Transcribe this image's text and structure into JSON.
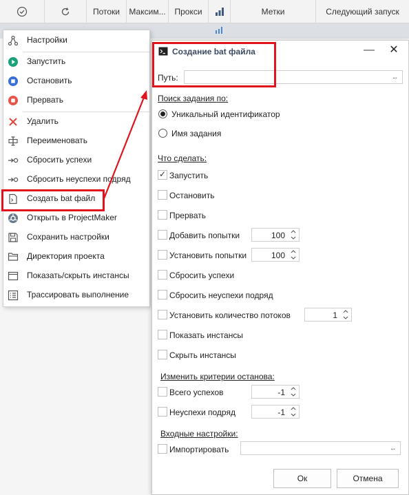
{
  "grid": {
    "columns": [
      "",
      "",
      "Потоки",
      "Максим...",
      "Прокси",
      "",
      "Метки",
      "Следующий запуск"
    ]
  },
  "context_menu": {
    "items": [
      {
        "label": "Настройки",
        "icon": "settings-icon"
      },
      {
        "label": "Запустить",
        "icon": "play-icon"
      },
      {
        "label": "Остановить",
        "icon": "stop-icon"
      },
      {
        "label": "Прервать",
        "icon": "abort-icon"
      },
      {
        "label": "Удалить",
        "icon": "delete-icon"
      },
      {
        "label": "Переименовать",
        "icon": "rename-icon"
      },
      {
        "label": "Сбросить успехи",
        "icon": "reset-success-icon"
      },
      {
        "label": "Сбросить неуспехи подряд",
        "icon": "reset-fails-icon"
      },
      {
        "label": "Создать bat файл",
        "icon": "bat-file-icon"
      },
      {
        "label": "Открыть в ProjectMaker",
        "icon": "projectmaker-icon"
      },
      {
        "label": "Сохранить настройки",
        "icon": "save-icon"
      },
      {
        "label": "Директория проекта",
        "icon": "folder-icon"
      },
      {
        "label": "Показать/скрыть инстансы",
        "icon": "window-icon"
      },
      {
        "label": "Трассировать выполнение",
        "icon": "trace-icon"
      }
    ]
  },
  "dialog": {
    "title": "Создание bat файла",
    "path_label": "Путь:",
    "path_value": "",
    "browse_label": "...",
    "search_by_title": "Поиск задания по:",
    "search_options": [
      "Уникальный идентификатор",
      "Имя задания"
    ],
    "what_to_do_title": "Что сделать:",
    "actions": {
      "start": "Запустить",
      "stop": "Остановить",
      "abort": "Прервать",
      "add_attempts": "Добавить попытки",
      "set_attempts": "Установить попытки",
      "reset_success": "Сбросить успехи",
      "reset_fails": "Сбросить неуспехи подряд",
      "set_threads": "Установить количество потоков",
      "show_instances": "Показать инстансы",
      "hide_instances": "Скрыть инстансы"
    },
    "add_attempts_value": "100",
    "set_attempts_value": "100",
    "threads_value": "1",
    "stop_criteria_title": "Изменить критерии останова:",
    "total_success_label": "Всего успехов",
    "total_success_value": "-1",
    "fails_in_row_label": "Неуспехи подряд",
    "fails_in_row_value": "-1",
    "input_settings_title": "Входные настройки:",
    "import_label": "Импортировать",
    "import_value": "",
    "ok_label": "Ок",
    "cancel_label": "Отмена"
  },
  "colors": {
    "highlight": "#e0141e",
    "play": "#1aa37a",
    "stop": "#3a6fd8",
    "abort": "#e8534a",
    "title": "#3b4a63"
  }
}
